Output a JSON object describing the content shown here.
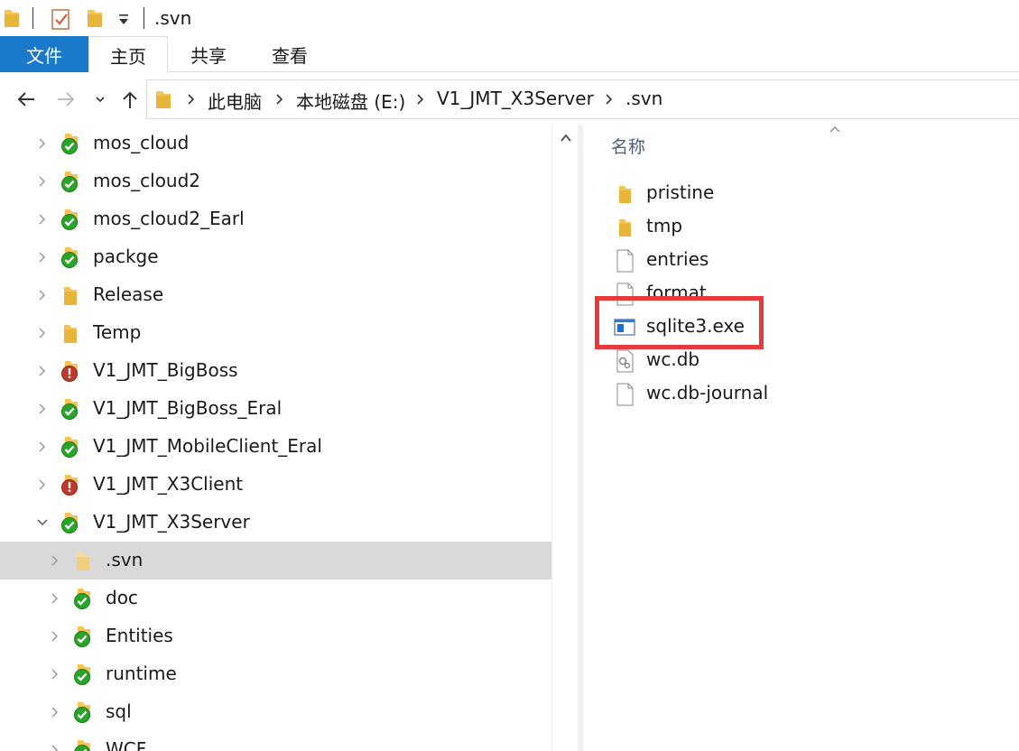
{
  "window": {
    "title": ".svn"
  },
  "ribbon": {
    "tabs": [
      {
        "label": "文件"
      },
      {
        "label": "主页"
      },
      {
        "label": "共享"
      },
      {
        "label": "查看"
      }
    ]
  },
  "address": {
    "crumbs": [
      "此电脑",
      "本地磁盘 (E:)",
      "V1_JMT_X3Server",
      ".svn"
    ]
  },
  "nav_tree": {
    "items": [
      {
        "label": "mos_cloud",
        "status": "ok"
      },
      {
        "label": "mos_cloud2",
        "status": "ok"
      },
      {
        "label": "mos_cloud2_Earl",
        "status": "ok"
      },
      {
        "label": "packge",
        "status": "ok"
      },
      {
        "label": "Release",
        "status": "folder"
      },
      {
        "label": "Temp",
        "status": "folder"
      },
      {
        "label": "V1_JMT_BigBoss",
        "status": "modified"
      },
      {
        "label": "V1_JMT_BigBoss_Eral",
        "status": "ok"
      },
      {
        "label": "V1_JMT_MobileClient_Eral",
        "status": "ok"
      },
      {
        "label": "V1_JMT_X3Client",
        "status": "modified"
      },
      {
        "label": "V1_JMT_X3Server",
        "status": "ok",
        "expanded": true
      },
      {
        "label": ".svn",
        "status": "folder-faded",
        "selected": true
      },
      {
        "label": "doc",
        "status": "ok"
      },
      {
        "label": "Entities",
        "status": "ok"
      },
      {
        "label": "runtime",
        "status": "ok"
      },
      {
        "label": "sql",
        "status": "ok"
      },
      {
        "label": "WCF",
        "status": "ok"
      }
    ]
  },
  "content": {
    "column_header": "名称",
    "files": [
      {
        "label": "pristine",
        "icon": "folder-icon"
      },
      {
        "label": "tmp",
        "icon": "folder-icon"
      },
      {
        "label": "entries",
        "icon": "file-icon"
      },
      {
        "label": "format",
        "icon": "file-icon"
      },
      {
        "label": "sqlite3.exe",
        "icon": "exe-icon"
      },
      {
        "label": "wc.db",
        "icon": "db-file-icon"
      },
      {
        "label": "wc.db-journal",
        "icon": "file-icon"
      }
    ]
  },
  "colors": {
    "file_tab": "#1979ca",
    "selection": "#d9d9d9",
    "highlight": "#e83a3a",
    "folder": "#f5c451",
    "svn_ok": "#2aa52a",
    "svn_modified": "#c0392b"
  }
}
